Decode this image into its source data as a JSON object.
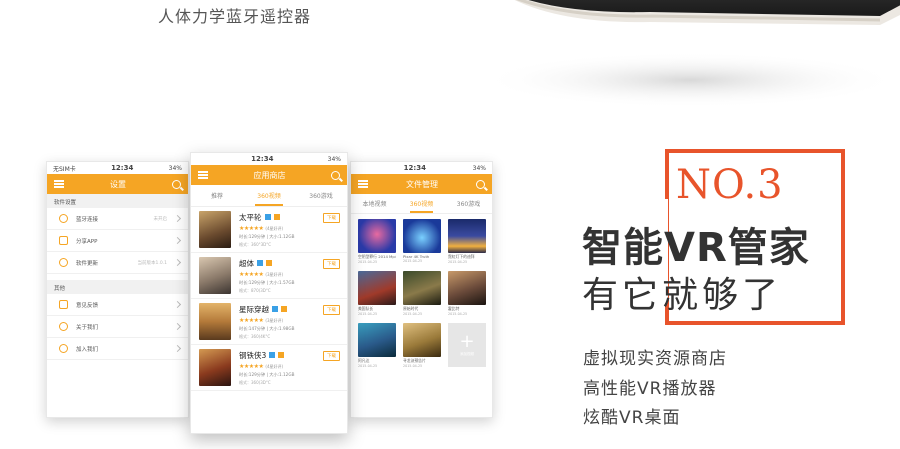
{
  "top": {
    "subtitle": "人体力学蓝牙遥控器"
  },
  "phones": {
    "settings": {
      "carrier": "无SIM卡",
      "time": "12:34",
      "battery": "34%",
      "title": "设置",
      "section1": "软件设置",
      "rows1": [
        {
          "label": "蓝牙连接",
          "value": "未开启"
        },
        {
          "label": "分享APP",
          "value": ""
        },
        {
          "label": "软件更新",
          "value": "当前版本1.0.1"
        }
      ],
      "section2": "其他",
      "rows2": [
        {
          "label": "意见反馈",
          "value": ""
        },
        {
          "label": "关于我们",
          "value": ""
        },
        {
          "label": "加入我们",
          "value": ""
        }
      ]
    },
    "store": {
      "time": "12:34",
      "battery": "34%",
      "title": "应用商店",
      "tabs": [
        "推荐",
        "360视频",
        "360游戏"
      ],
      "download_label": "下载",
      "movies": [
        {
          "title": "太平轮",
          "stars": "★★★★★",
          "score": "(4星好评)",
          "meta": "时长:129分钟 | 大小:1.12GB",
          "format": "格式：360°3D°C"
        },
        {
          "title": "超体",
          "stars": "★★★★★",
          "score": "(3星好评)",
          "meta": "时长:129分钟 | 大小:1.57GB",
          "format": "格式：870(3D°C"
        },
        {
          "title": "星际穿越",
          "stars": "★★★★★",
          "score": "(3星好评)",
          "meta": "时长:147分钟 | 大小:1.98GB",
          "format": "格式：360(4K°C"
        },
        {
          "title": "钢铁侠3",
          "stars": "★★★★★",
          "score": "(4星好评)",
          "meta": "时长:129分钟 | 大小:1.12GB",
          "format": "格式：360(3D°C"
        }
      ]
    },
    "files": {
      "time": "12:34",
      "battery": "34%",
      "title": "文件管理",
      "tabs": [
        "本地视频",
        "360视频",
        "360游戏"
      ],
      "items": [
        {
          "name": "空阴型罪行 2014 Mp4",
          "date": "2015-04-25"
        },
        {
          "name": "Pixar 4K Truth",
          "date": "2015-04-25"
        },
        {
          "name": "霓虹灯下的迪拜",
          "date": "2015-04-25"
        },
        {
          "name": "美国队长",
          "date": "2015-04-25"
        },
        {
          "name": "原始时代",
          "date": "2015-04-25"
        },
        {
          "name": "霍比特",
          "date": "2015-04-25"
        },
        {
          "name": "阿凡达",
          "date": "2015-04-25"
        },
        {
          "name": "寻龙诀预告片",
          "date": "2015-04-25"
        }
      ],
      "add_label": "添加视频"
    }
  },
  "promo": {
    "badge": "NO.3",
    "headline": "智能VR管家",
    "slogan": "有它就够了",
    "features": [
      "虚拟现实资源商店",
      "高性能VR播放器",
      "炫酷VR桌面"
    ]
  },
  "colors": {
    "accent": "#f5a524",
    "badge": "#e8542b"
  }
}
